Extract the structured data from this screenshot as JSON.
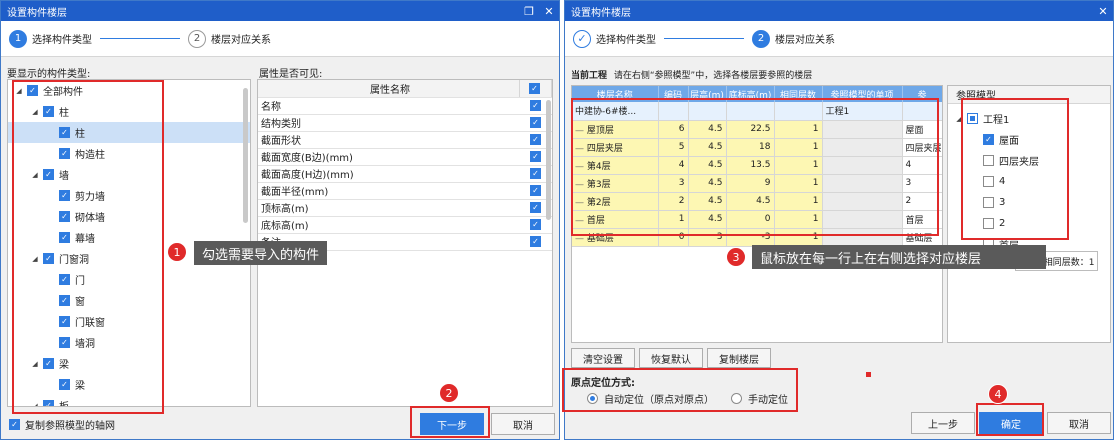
{
  "dialog1": {
    "title": "设置构件楼层",
    "steps": [
      {
        "num": "1",
        "label": "选择构件类型"
      },
      {
        "num": "2",
        "label": "楼层对应关系"
      }
    ],
    "left_label": "要显示的构件类型:",
    "right_label": "属性是否可见:",
    "tree": [
      {
        "label": "全部构件",
        "level": 0,
        "expanded": true,
        "state": "checked"
      },
      {
        "label": "柱",
        "level": 1,
        "expanded": true,
        "state": "checked"
      },
      {
        "label": "柱",
        "level": 2,
        "state": "checked",
        "selected": true
      },
      {
        "label": "构造柱",
        "level": 2,
        "state": "checked"
      },
      {
        "label": "墙",
        "level": 1,
        "expanded": true,
        "state": "checked"
      },
      {
        "label": "剪力墙",
        "level": 2,
        "state": "checked"
      },
      {
        "label": "砌体墙",
        "level": 2,
        "state": "checked"
      },
      {
        "label": "幕墙",
        "level": 2,
        "state": "checked"
      },
      {
        "label": "门窗洞",
        "level": 1,
        "expanded": true,
        "state": "checked"
      },
      {
        "label": "门",
        "level": 2,
        "state": "checked"
      },
      {
        "label": "窗",
        "level": 2,
        "state": "checked"
      },
      {
        "label": "门联窗",
        "level": 2,
        "state": "checked"
      },
      {
        "label": "墙洞",
        "level": 2,
        "state": "checked"
      },
      {
        "label": "梁",
        "level": 1,
        "expanded": true,
        "state": "checked"
      },
      {
        "label": "梁",
        "level": 2,
        "state": "checked"
      },
      {
        "label": "板",
        "level": 1,
        "expanded": true,
        "state": "checked"
      }
    ],
    "prop_header": "属性名称",
    "props": [
      "名称",
      "结构类别",
      "截面形状",
      "截面宽度(B边)(mm)",
      "截面高度(H边)(mm)",
      "截面半径(mm)",
      "顶标高(m)",
      "底标高(m)",
      "备注"
    ],
    "copy_axis_label": "复制参照模型的轴网",
    "next_button": "下一步",
    "cancel_button": "取消"
  },
  "dialog2": {
    "title": "设置构件楼层",
    "current_project_label": "当前工程",
    "instruction": "请在右侧“参照模型”中，选择各楼层要参照的楼层",
    "columns": [
      "楼层名称",
      "编码",
      "层高(m)",
      "底标高(m)",
      "相同层数",
      "参照模型的单项",
      "参"
    ],
    "project_row": {
      "name": "中建协-6#楼...",
      "ref_unit": "工程1"
    },
    "floors": [
      {
        "name": "屋顶层",
        "code": "6",
        "height": "4.5",
        "base": "22.5",
        "same": "1",
        "ref": "屋面"
      },
      {
        "name": "四层夹层",
        "code": "5",
        "height": "4.5",
        "base": "18",
        "same": "1",
        "ref": "四层夹层"
      },
      {
        "name": "第4层",
        "code": "4",
        "height": "4.5",
        "base": "13.5",
        "same": "1",
        "ref": "4"
      },
      {
        "name": "第3层",
        "code": "3",
        "height": "4.5",
        "base": "9",
        "same": "1",
        "ref": "3"
      },
      {
        "name": "第2层",
        "code": "2",
        "height": "4.5",
        "base": "4.5",
        "same": "1",
        "ref": "2"
      },
      {
        "name": "首层",
        "code": "1",
        "height": "4.5",
        "base": "0",
        "same": "1",
        "ref": "首层"
      },
      {
        "name": "基础层",
        "code": "0",
        "height": "3",
        "base": "-3",
        "same": "1",
        "ref": "基础层"
      }
    ],
    "ref_model_label": "参照模型",
    "ref_tree": [
      {
        "label": "工程1",
        "level": 0,
        "state": "partial"
      },
      {
        "label": "屋面",
        "level": 1,
        "state": "checked"
      },
      {
        "label": "四层夹层",
        "level": 1,
        "state": "unchecked"
      },
      {
        "label": "4",
        "level": 1,
        "state": "unchecked"
      },
      {
        "label": "3",
        "level": 1,
        "state": "unchecked"
      },
      {
        "label": "2",
        "level": 1,
        "state": "unchecked"
      },
      {
        "label": "首层",
        "level": 1,
        "state": "unchecked"
      }
    ],
    "tooltip_fragment": "~4.5 相同层数：1",
    "clear_button": "清空设置",
    "restore_button": "恢复默认",
    "copy_floor_button": "复制楼层",
    "origin_label": "原点定位方式:",
    "auto_option": "自动定位（原点对原点）",
    "manual_option": "手动定位",
    "prev_button": "上一步",
    "ok_button": "确定",
    "cancel_button": "取消"
  },
  "annotations": {
    "callout1": "勾选需要导入的构件",
    "callout3": "鼠标放在每一行上在右侧选择对应楼层",
    "badges": [
      "1",
      "2",
      "3",
      "4"
    ]
  },
  "icons": {
    "checkbox_checked": "check-icon",
    "close": "close-icon",
    "restore": "restore-icon"
  },
  "colors": {
    "titlebar": "#1f5ec9",
    "accent": "#2f7ce0",
    "annotation_red": "#e02a2a",
    "callout_bg": "#5a5a5a",
    "floor_yellow": "#fdf7b3",
    "table_header": "#6fa8e8"
  }
}
